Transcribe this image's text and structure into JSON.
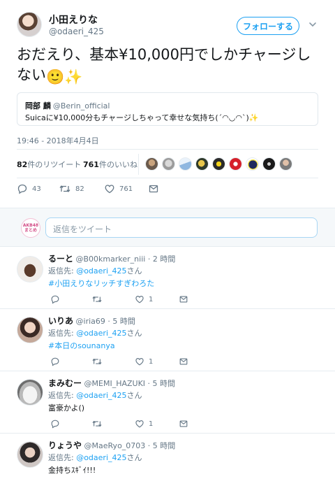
{
  "tweet": {
    "author_name": "小田えりな",
    "author_handle": "@odaeri_425",
    "follow_label": "フォローする",
    "text": "おだえり、基本¥10,000円でしかチャージしない",
    "text_emojis": "🙂✨",
    "quote": {
      "author_name": "岡部 麟",
      "author_handle": "@Berin_official",
      "text": "Suicaに¥10,000分もチャージしちゃって幸せな気持ち(´◠◡◠`)✨"
    },
    "timestamp": "19:46 - 2018年4月4日",
    "retweets_count": "82",
    "retweets_label": "件のリツイート",
    "likes_count": "761",
    "likes_label": "件のいいね",
    "actions": {
      "reply_count": "43",
      "retweet_count": "82",
      "like_count": "761"
    }
  },
  "compose": {
    "avatar_text_1": "AKB48",
    "avatar_text_2": "まとめ",
    "placeholder": "返信をツイート"
  },
  "replies": [
    {
      "name": "るーと",
      "handle": "@B00kmarker_niii",
      "time": "2 時間",
      "reply_prefix": "返信先: ",
      "reply_to": "@odaeri_425",
      "reply_suffix": "さん",
      "body": "#小田えりなリッチすぎわろた",
      "like_count": "1"
    },
    {
      "name": "いりあ",
      "handle": "@iria69",
      "time": "5 時間",
      "reply_prefix": "返信先: ",
      "reply_to": "@odaeri_425",
      "reply_suffix": "さん",
      "body": "#本日のsounanya",
      "like_count": "1"
    },
    {
      "name": "まみむー",
      "handle": "@MEMI_HAZUKI",
      "time": "5 時間",
      "reply_prefix": "返信先: ",
      "reply_to": "@odaeri_425",
      "reply_suffix": "さん",
      "body": "富豪かよ()",
      "like_count": "1"
    },
    {
      "name": "りょうや",
      "handle": "@MaeRyo_0703",
      "time": "5 時間",
      "reply_prefix": "返信先: ",
      "reply_to": "@odaeri_425",
      "reply_suffix": "さん",
      "body": "金持ちｽｷﾞｲ!!!",
      "like_count": ""
    }
  ],
  "colors": {
    "accent": "#1da1f2",
    "secondary_text": "#657786",
    "border": "#e6ecf0"
  },
  "icons": [
    "chevron-down-icon",
    "reply-icon",
    "retweet-icon",
    "heart-icon",
    "dm-icon"
  ]
}
